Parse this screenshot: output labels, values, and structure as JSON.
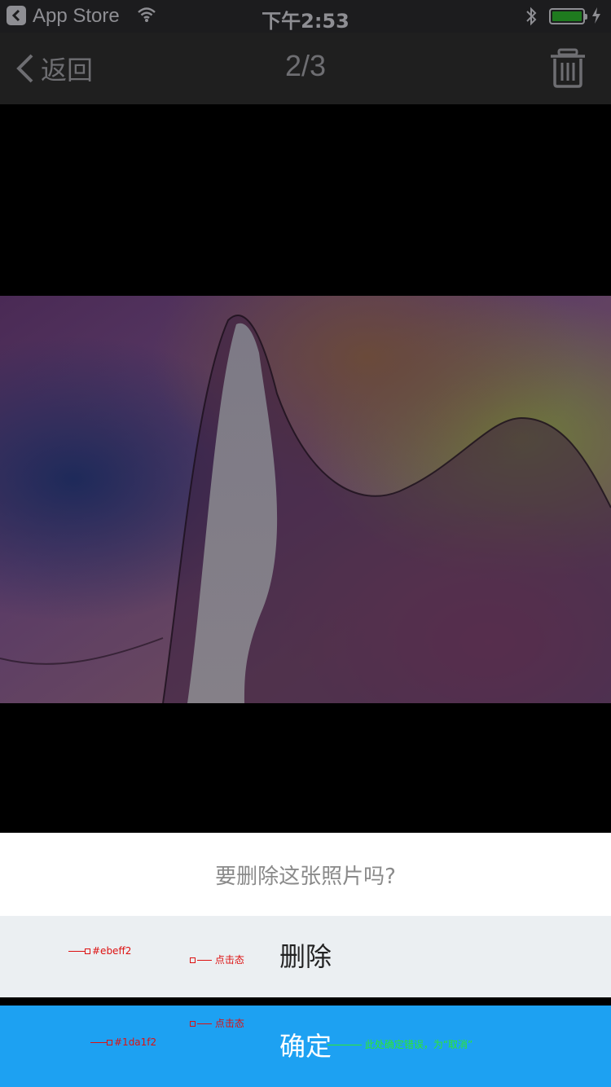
{
  "status_bar": {
    "back_app_label": "App Store",
    "time": "下午2:53",
    "icons": [
      "back-arrow-icon",
      "wifi-icon",
      "bluetooth-icon",
      "battery-icon",
      "charging-icon"
    ]
  },
  "nav": {
    "back_label": "返回",
    "title": "2/3",
    "icons": [
      "chevron-left-icon",
      "trash-icon"
    ]
  },
  "action_sheet": {
    "message": "要删除这张照片吗?",
    "delete_label": "删除",
    "confirm_label": "确定"
  },
  "annotations": {
    "delete_bg": "#ebeff2",
    "delete_pressed": "点击态",
    "confirm_pressed": "点击态",
    "confirm_bg": "#1da1f2",
    "confirm_note": "此处确定错误，为“取消”"
  },
  "colors": {
    "delete_bg": "#ebeff2",
    "confirm_bg": "#1da1f2",
    "note_red": "#dd1111",
    "note_green": "#2ee82e"
  }
}
